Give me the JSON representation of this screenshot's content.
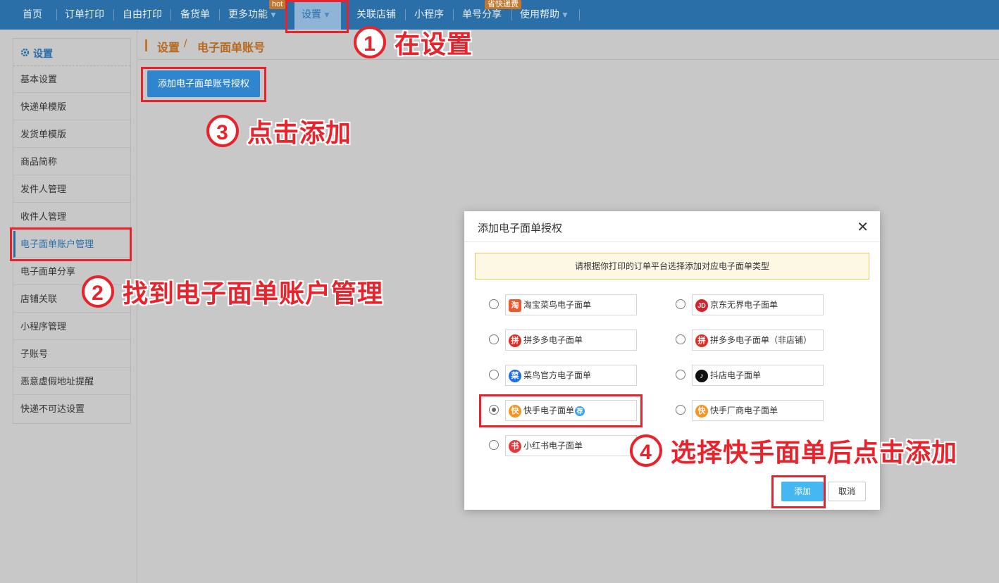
{
  "nav": {
    "items": [
      {
        "label": "首页"
      },
      {
        "label": "订单打印"
      },
      {
        "label": "自由打印"
      },
      {
        "label": "备货单"
      },
      {
        "label": "更多功能"
      },
      {
        "label": "设置"
      },
      {
        "label": "关联店铺"
      },
      {
        "label": "小程序"
      },
      {
        "label": "单号分享"
      },
      {
        "label": "使用帮助"
      }
    ],
    "badge_hot": "hot",
    "badge_save": "省快递费",
    "dropdown_arrow": "▼"
  },
  "breadcrumb": {
    "root": "设置",
    "separator": "/",
    "current": "电子面单账号"
  },
  "sidebar": {
    "heading": "设置",
    "items": [
      {
        "label": "基本设置"
      },
      {
        "label": "快递单模版"
      },
      {
        "label": "发货单模版"
      },
      {
        "label": "商品简称"
      },
      {
        "label": "发件人管理"
      },
      {
        "label": "收件人管理"
      },
      {
        "label": "电子面单账户管理"
      },
      {
        "label": "电子面单分享"
      },
      {
        "label": "店铺关联"
      },
      {
        "label": "小程序管理"
      },
      {
        "label": "子账号"
      },
      {
        "label": "恶意虚假地址提醒"
      },
      {
        "label": "快递不可达设置"
      }
    ],
    "active_item": "电子面单账户管理"
  },
  "main": {
    "add_button": "添加电子面单账号授权"
  },
  "modal": {
    "title": "添加电子面单授权",
    "close": "✕",
    "notice": "请根据你打印的订单平台选择添加对应电子面单类型",
    "options": [
      {
        "label": "淘宝菜鸟电子面单",
        "logo": "淘",
        "logo_color": "#f0562b",
        "selected": false
      },
      {
        "label": "京东无界电子面单",
        "logo": "JD",
        "logo_color": "#d7212c",
        "selected": false
      },
      {
        "label": "拼多多电子面单",
        "logo": "拼",
        "logo_color": "#e02e24",
        "selected": false
      },
      {
        "label": "拼多多电子面单（非店铺）",
        "logo": "拼",
        "logo_color": "#e02e24",
        "selected": false
      },
      {
        "label": "菜鸟官方电子面单",
        "logo": "菜",
        "logo_color": "#1c6cf0",
        "selected": false
      },
      {
        "label": "抖店电子面单",
        "logo": "♪",
        "logo_color": "#111111",
        "selected": false
      },
      {
        "label": "快手电子面单",
        "logo": "快",
        "logo_color": "#f7941d",
        "selected": true,
        "tag": "荐",
        "tag_color": "#3aa2e8"
      },
      {
        "label": "快手厂商电子面单",
        "logo": "快",
        "logo_color": "#f7941d",
        "selected": false
      },
      {
        "label": "小红书电子面单",
        "logo": "书",
        "logo_color": "#e4393c",
        "selected": false
      }
    ],
    "add_button": "添加",
    "cancel_button": "取消"
  },
  "annotations": [
    {
      "number": "1",
      "text": "在设置"
    },
    {
      "number": "2",
      "text": "找到电子面单账户管理"
    },
    {
      "number": "3",
      "text": "点击添加"
    },
    {
      "number": "4",
      "text": "选择快手面单后点击添加"
    }
  ],
  "colors": {
    "nav_bg": "#2a6fa8",
    "annotation_red": "#e8232b",
    "primary_button": "#2f86cf",
    "modal_add_button": "#45b7f2",
    "breadcrumb_accent": "#b7691f"
  }
}
